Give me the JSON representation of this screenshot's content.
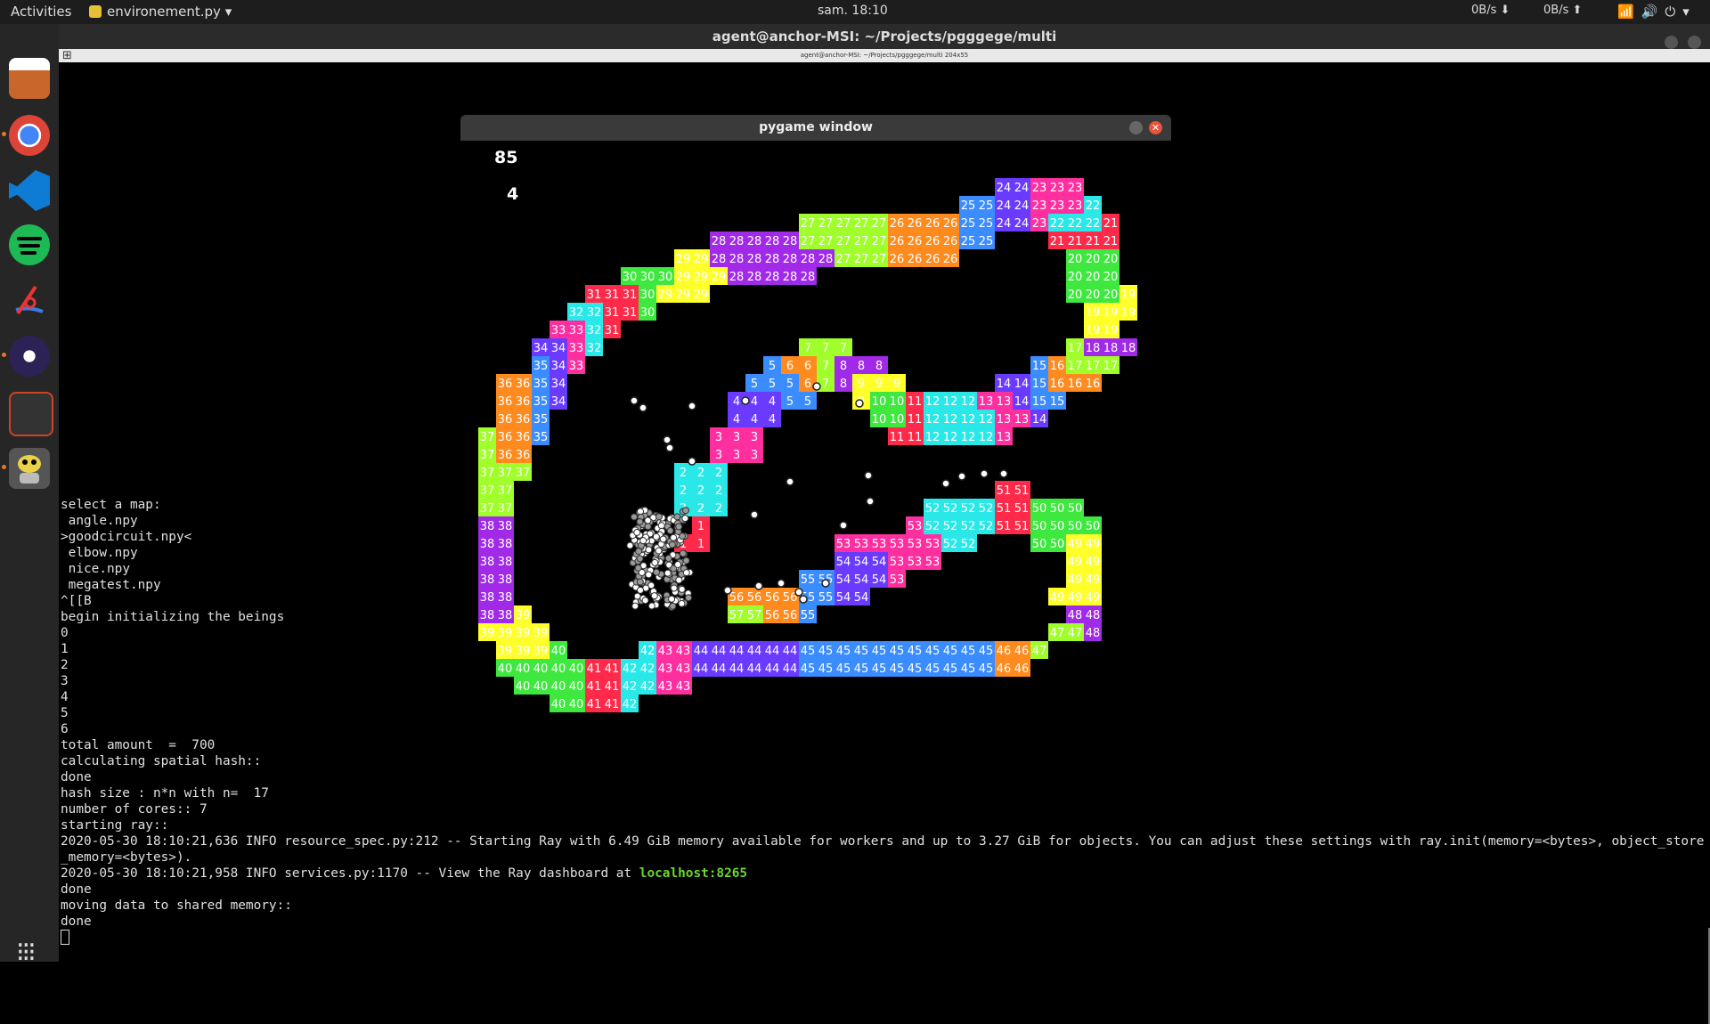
{
  "topbar": {
    "activities": "Activities",
    "app_name": "environement.py ▾",
    "clock": "sam. 18:10",
    "net_down": "0B/s ⬇",
    "net_up": "0B/s ⬆",
    "system_icons": "📶🔊⏻▾"
  },
  "terminal": {
    "title": "agent@anchor-MSI: ~/Projects/pgggege/multi",
    "tab_label": "agent@anchor-MSI: ~/Projects/pgggege/multi 204x55",
    "lines": [
      "select a map:",
      " angle.npy",
      ">goodcircuit.npy<",
      " elbow.npy",
      " nice.npy",
      " megatest.npy",
      "^[[B",
      "begin initializing the beings",
      "0",
      "1",
      "2",
      "3",
      "4",
      "5",
      "6",
      "total amount  =  700",
      "calculating spatial hash::",
      "done",
      "hash size : n*n with n=  17",
      "number of cores:: 7",
      "starting ray::",
      "2020-05-30 18:10:21,636 INFO resource_spec.py:212 -- Starting Ray with 6.49 GiB memory available for workers and up to 3.27 GiB for objects. You can adjust these settings with ray.init(memory=<bytes>, object_store_memory=<bytes>).",
      "2020-05-30 18:10:21,958 INFO services.py:1170 -- View the Ray dashboard at ",
      "done",
      "moving data to shared memory::",
      "done"
    ],
    "dashboard_link": "localhost:8265"
  },
  "pygame": {
    "title": "pygame window",
    "score": "85",
    "generation": "4",
    "close_glyph": "✕"
  },
  "palette": {
    "green": "#3ee83e",
    "pink": "#ff2fa0",
    "orange": "#ff8a1e",
    "yellow": "#ffff2a",
    "cyan": "#2ae8e8",
    "blue": "#3a8cff",
    "purple": "#a02ae8",
    "red": "#ff2a4a",
    "violet": "#6a3aff",
    "lime": "#a0ff2a"
  },
  "track_cells": [
    [
      3,
      0,
      24
    ],
    [
      4,
      0,
      24
    ],
    [
      5,
      0,
      23
    ],
    [
      6,
      0,
      23
    ],
    [
      7,
      0,
      23
    ],
    [
      1,
      1,
      25
    ],
    [
      2,
      1,
      25
    ],
    [
      3,
      1,
      24
    ],
    [
      4,
      1,
      24
    ],
    [
      5,
      1,
      23
    ],
    [
      6,
      1,
      23
    ],
    [
      7,
      1,
      23
    ],
    [
      8,
      1,
      22
    ],
    [
      -8,
      2,
      27
    ],
    [
      -7,
      2,
      27
    ],
    [
      -6,
      2,
      27
    ],
    [
      -5,
      2,
      27
    ],
    [
      -4,
      2,
      27
    ],
    [
      -3,
      2,
      26
    ],
    [
      -2,
      2,
      26
    ],
    [
      -1,
      2,
      26
    ],
    [
      0,
      2,
      26
    ],
    [
      1,
      2,
      25
    ],
    [
      2,
      2,
      25
    ],
    [
      3,
      2,
      24
    ],
    [
      4,
      2,
      24
    ],
    [
      5,
      2,
      23
    ],
    [
      6,
      2,
      22
    ],
    [
      7,
      2,
      22
    ],
    [
      8,
      2,
      22
    ],
    [
      9,
      2,
      21
    ],
    [
      -13,
      3,
      28
    ],
    [
      -12,
      3,
      28
    ],
    [
      -11,
      3,
      28
    ],
    [
      -10,
      3,
      28
    ],
    [
      -9,
      3,
      28
    ],
    [
      -8,
      3,
      27
    ],
    [
      -7,
      3,
      27
    ],
    [
      -6,
      3,
      27
    ],
    [
      -5,
      3,
      27
    ],
    [
      -4,
      3,
      27
    ],
    [
      -3,
      3,
      26
    ],
    [
      -2,
      3,
      26
    ],
    [
      -1,
      3,
      26
    ],
    [
      0,
      3,
      26
    ],
    [
      1,
      3,
      25
    ],
    [
      2,
      3,
      25
    ],
    [
      6,
      3,
      21
    ],
    [
      7,
      3,
      21
    ],
    [
      8,
      3,
      21
    ],
    [
      9,
      3,
      21
    ],
    [
      -15,
      4,
      29
    ],
    [
      -14,
      4,
      29
    ],
    [
      -13,
      4,
      28
    ],
    [
      -12,
      4,
      28
    ],
    [
      -11,
      4,
      28
    ],
    [
      -10,
      4,
      28
    ],
    [
      -9,
      4,
      28
    ],
    [
      -8,
      4,
      28
    ],
    [
      -7,
      4,
      28
    ],
    [
      -6,
      4,
      27
    ],
    [
      -5,
      4,
      27
    ],
    [
      -4,
      4,
      27
    ],
    [
      -3,
      4,
      26
    ],
    [
      -2,
      4,
      26
    ],
    [
      -1,
      4,
      26
    ],
    [
      0,
      4,
      26
    ],
    [
      7,
      4,
      20
    ],
    [
      8,
      4,
      20
    ],
    [
      9,
      4,
      20
    ],
    [
      -18,
      5,
      30
    ],
    [
      -17,
      5,
      30
    ],
    [
      -16,
      5,
      30
    ],
    [
      -15,
      5,
      29
    ],
    [
      -14,
      5,
      29
    ],
    [
      -13,
      5,
      29
    ],
    [
      -12,
      5,
      28
    ],
    [
      -11,
      5,
      28
    ],
    [
      -10,
      5,
      28
    ],
    [
      -9,
      5,
      28
    ],
    [
      -8,
      5,
      28
    ],
    [
      7,
      5,
      20
    ],
    [
      8,
      5,
      20
    ],
    [
      9,
      5,
      20
    ],
    [
      -20,
      6,
      31
    ],
    [
      -19,
      6,
      31
    ],
    [
      -18,
      6,
      31
    ],
    [
      -17,
      6,
      30
    ],
    [
      -16,
      6,
      29
    ],
    [
      -15,
      6,
      29
    ],
    [
      -14,
      6,
      29
    ],
    [
      7,
      6,
      20
    ],
    [
      8,
      6,
      20
    ],
    [
      9,
      6,
      20
    ],
    [
      10,
      6,
      19
    ],
    [
      -21,
      7,
      32
    ],
    [
      -20,
      7,
      32
    ],
    [
      -19,
      7,
      31
    ],
    [
      -18,
      7,
      31
    ],
    [
      -17,
      7,
      30
    ],
    [
      8,
      7,
      19
    ],
    [
      9,
      7,
      19
    ],
    [
      10,
      7,
      19
    ],
    [
      -22,
      8,
      33
    ],
    [
      -21,
      8,
      33
    ],
    [
      -20,
      8,
      32
    ],
    [
      -19,
      8,
      31
    ],
    [
      8,
      8,
      19
    ],
    [
      9,
      8,
      19
    ],
    [
      -23,
      9,
      34
    ],
    [
      -22,
      9,
      34
    ],
    [
      -21,
      9,
      33
    ],
    [
      -20,
      9,
      32
    ],
    [
      -8,
      9,
      7
    ],
    [
      -7,
      9,
      7
    ],
    [
      -6,
      9,
      7
    ],
    [
      7,
      9,
      17
    ],
    [
      8,
      9,
      18
    ],
    [
      9,
      9,
      18
    ],
    [
      10,
      9,
      18
    ],
    [
      -23,
      10,
      35
    ],
    [
      -22,
      10,
      34
    ],
    [
      -21,
      10,
      33
    ],
    [
      -10,
      10,
      5
    ],
    [
      -9,
      10,
      6
    ],
    [
      -8,
      10,
      6
    ],
    [
      -7,
      10,
      7
    ],
    [
      -6,
      10,
      8
    ],
    [
      -5,
      10,
      8
    ],
    [
      -4,
      10,
      8
    ],
    [
      5,
      10,
      15
    ],
    [
      6,
      10,
      16
    ],
    [
      7,
      10,
      17
    ],
    [
      8,
      10,
      17
    ],
    [
      9,
      10,
      17
    ],
    [
      -25,
      11,
      36
    ],
    [
      -24,
      11,
      36
    ],
    [
      -23,
      11,
      35
    ],
    [
      -22,
      11,
      34
    ],
    [
      -11,
      11,
      5
    ],
    [
      -10,
      11,
      5
    ],
    [
      -9,
      11,
      5
    ],
    [
      -8,
      11,
      6
    ],
    [
      -7,
      11,
      7
    ],
    [
      -6,
      11,
      8
    ],
    [
      -5,
      11,
      9
    ],
    [
      -4,
      11,
      9
    ],
    [
      -3,
      11,
      9
    ],
    [
      3,
      11,
      14
    ],
    [
      4,
      11,
      14
    ],
    [
      5,
      11,
      15
    ],
    [
      6,
      11,
      16
    ],
    [
      7,
      11,
      16
    ],
    [
      8,
      11,
      16
    ],
    [
      -25,
      12,
      36
    ],
    [
      -24,
      12,
      36
    ],
    [
      -23,
      12,
      35
    ],
    [
      -22,
      12,
      34
    ],
    [
      -12,
      12,
      4
    ],
    [
      -11,
      12,
      4
    ],
    [
      -10,
      12,
      4
    ],
    [
      -9,
      12,
      5
    ],
    [
      -8,
      12,
      5
    ],
    [
      -5,
      12,
      9
    ],
    [
      -4,
      12,
      10
    ],
    [
      -3,
      12,
      10
    ],
    [
      -2,
      12,
      11
    ],
    [
      -1,
      12,
      12
    ],
    [
      0,
      12,
      12
    ],
    [
      1,
      12,
      12
    ],
    [
      2,
      12,
      13
    ],
    [
      3,
      12,
      13
    ],
    [
      4,
      12,
      14
    ],
    [
      5,
      12,
      15
    ],
    [
      6,
      12,
      15
    ],
    [
      -25,
      13,
      36
    ],
    [
      -24,
      13,
      36
    ],
    [
      -23,
      13,
      35
    ],
    [
      -12,
      13,
      4
    ],
    [
      -11,
      13,
      4
    ],
    [
      -10,
      13,
      4
    ],
    [
      -4,
      13,
      10
    ],
    [
      -3,
      13,
      10
    ],
    [
      -2,
      13,
      11
    ],
    [
      -1,
      13,
      12
    ],
    [
      0,
      13,
      12
    ],
    [
      1,
      13,
      12
    ],
    [
      2,
      13,
      12
    ],
    [
      3,
      13,
      13
    ],
    [
      4,
      13,
      13
    ],
    [
      5,
      13,
      14
    ],
    [
      -26,
      14,
      37
    ],
    [
      -25,
      14,
      36
    ],
    [
      -24,
      14,
      36
    ],
    [
      -23,
      14,
      35
    ],
    [
      -13,
      14,
      3
    ],
    [
      -12,
      14,
      3
    ],
    [
      -11,
      14,
      3
    ],
    [
      -3,
      14,
      11
    ],
    [
      -2,
      14,
      11
    ],
    [
      -1,
      14,
      12
    ],
    [
      0,
      14,
      12
    ],
    [
      1,
      14,
      12
    ],
    [
      2,
      14,
      12
    ],
    [
      3,
      14,
      13
    ],
    [
      -26,
      15,
      37
    ],
    [
      -25,
      15,
      36
    ],
    [
      -24,
      15,
      36
    ],
    [
      -13,
      15,
      3
    ],
    [
      -12,
      15,
      3
    ],
    [
      -11,
      15,
      3
    ],
    [
      -26,
      16,
      37
    ],
    [
      -25,
      16,
      37
    ],
    [
      -24,
      16,
      37
    ],
    [
      -15,
      16,
      2
    ],
    [
      -14,
      16,
      2
    ],
    [
      -13,
      16,
      2
    ],
    [
      -26,
      17,
      37
    ],
    [
      -25,
      17,
      37
    ],
    [
      -15,
      17,
      2
    ],
    [
      -14,
      17,
      2
    ],
    [
      -13,
      17,
      2
    ],
    [
      3,
      17,
      51
    ],
    [
      4,
      17,
      51
    ],
    [
      -26,
      18,
      37
    ],
    [
      -25,
      18,
      37
    ],
    [
      -15,
      18,
      2
    ],
    [
      -14,
      18,
      2
    ],
    [
      -13,
      18,
      2
    ],
    [
      -1,
      18,
      52
    ],
    [
      0,
      18,
      52
    ],
    [
      1,
      18,
      52
    ],
    [
      2,
      18,
      52
    ],
    [
      3,
      18,
      51
    ],
    [
      4,
      18,
      51
    ],
    [
      5,
      18,
      50
    ],
    [
      6,
      18,
      50
    ],
    [
      7,
      18,
      50
    ],
    [
      -26,
      19,
      38
    ],
    [
      -25,
      19,
      38
    ],
    [
      -14,
      19,
      1
    ],
    [
      -2,
      19,
      53
    ],
    [
      -1,
      19,
      52
    ],
    [
      0,
      19,
      52
    ],
    [
      1,
      19,
      52
    ],
    [
      2,
      19,
      52
    ],
    [
      3,
      19,
      51
    ],
    [
      4,
      19,
      51
    ],
    [
      5,
      19,
      50
    ],
    [
      6,
      19,
      50
    ],
    [
      7,
      19,
      50
    ],
    [
      8,
      19,
      50
    ],
    [
      -26,
      20,
      38
    ],
    [
      -25,
      20,
      38
    ],
    [
      -15,
      20,
      1
    ],
    [
      -14,
      20,
      1
    ],
    [
      -6,
      20,
      53
    ],
    [
      -5,
      20,
      53
    ],
    [
      -4,
      20,
      53
    ],
    [
      -3,
      20,
      53
    ],
    [
      -2,
      20,
      53
    ],
    [
      -1,
      20,
      53
    ],
    [
      0,
      20,
      52
    ],
    [
      1,
      20,
      52
    ],
    [
      5,
      20,
      50
    ],
    [
      6,
      20,
      50
    ],
    [
      7,
      20,
      49
    ],
    [
      8,
      20,
      49
    ],
    [
      -26,
      21,
      38
    ],
    [
      -25,
      21,
      38
    ],
    [
      -6,
      21,
      54
    ],
    [
      -5,
      21,
      54
    ],
    [
      -4,
      21,
      54
    ],
    [
      -3,
      21,
      53
    ],
    [
      -2,
      21,
      53
    ],
    [
      -1,
      21,
      53
    ],
    [
      7,
      21,
      49
    ],
    [
      8,
      21,
      49
    ],
    [
      -26,
      22,
      38
    ],
    [
      -25,
      22,
      38
    ],
    [
      -8,
      22,
      55
    ],
    [
      -7,
      22,
      55
    ],
    [
      -6,
      22,
      54
    ],
    [
      -5,
      22,
      54
    ],
    [
      -4,
      22,
      54
    ],
    [
      -3,
      22,
      53
    ],
    [
      7,
      22,
      49
    ],
    [
      8,
      22,
      49
    ],
    [
      -26,
      23,
      38
    ],
    [
      -25,
      23,
      38
    ],
    [
      -12,
      23,
      56
    ],
    [
      -11,
      23,
      56
    ],
    [
      -10,
      23,
      56
    ],
    [
      -9,
      23,
      56
    ],
    [
      -8,
      23,
      55
    ],
    [
      -7,
      23,
      55
    ],
    [
      -6,
      23,
      54
    ],
    [
      -5,
      23,
      54
    ],
    [
      6,
      23,
      49
    ],
    [
      7,
      23,
      49
    ],
    [
      8,
      23,
      49
    ],
    [
      -26,
      24,
      38
    ],
    [
      -25,
      24,
      38
    ],
    [
      -24,
      24,
      39
    ],
    [
      -12,
      24,
      57
    ],
    [
      -11,
      24,
      57
    ],
    [
      -10,
      24,
      56
    ],
    [
      -9,
      24,
      56
    ],
    [
      -8,
      24,
      55
    ],
    [
      7,
      24,
      48
    ],
    [
      8,
      24,
      48
    ],
    [
      -26,
      25,
      39
    ],
    [
      -25,
      25,
      39
    ],
    [
      -24,
      25,
      39
    ],
    [
      -23,
      25,
      39
    ],
    [
      6,
      25,
      47
    ],
    [
      7,
      25,
      47
    ],
    [
      8,
      25,
      48
    ],
    [
      -25,
      26,
      39
    ],
    [
      -24,
      26,
      39
    ],
    [
      -23,
      26,
      39
    ],
    [
      -22,
      26,
      40
    ],
    [
      -17,
      26,
      42
    ],
    [
      -16,
      26,
      43
    ],
    [
      -15,
      26,
      43
    ],
    [
      -14,
      26,
      44
    ],
    [
      -13,
      26,
      44
    ],
    [
      -12,
      26,
      44
    ],
    [
      -11,
      26,
      44
    ],
    [
      -10,
      26,
      44
    ],
    [
      -9,
      26,
      44
    ],
    [
      -8,
      26,
      45
    ],
    [
      -7,
      26,
      45
    ],
    [
      -6,
      26,
      45
    ],
    [
      -5,
      26,
      45
    ],
    [
      -4,
      26,
      45
    ],
    [
      -3,
      26,
      45
    ],
    [
      -2,
      26,
      45
    ],
    [
      -1,
      26,
      45
    ],
    [
      0,
      26,
      45
    ],
    [
      1,
      26,
      45
    ],
    [
      2,
      26,
      45
    ],
    [
      3,
      26,
      46
    ],
    [
      4,
      26,
      46
    ],
    [
      5,
      26,
      47
    ],
    [
      -25,
      27,
      40
    ],
    [
      -24,
      27,
      40
    ],
    [
      -23,
      27,
      40
    ],
    [
      -22,
      27,
      40
    ],
    [
      -21,
      27,
      40
    ],
    [
      -20,
      27,
      41
    ],
    [
      -19,
      27,
      41
    ],
    [
      -18,
      27,
      42
    ],
    [
      -17,
      27,
      42
    ],
    [
      -16,
      27,
      43
    ],
    [
      -15,
      27,
      43
    ],
    [
      -14,
      27,
      44
    ],
    [
      -13,
      27,
      44
    ],
    [
      -12,
      27,
      44
    ],
    [
      -11,
      27,
      44
    ],
    [
      -10,
      27,
      44
    ],
    [
      -9,
      27,
      44
    ],
    [
      -8,
      27,
      45
    ],
    [
      -7,
      27,
      45
    ],
    [
      -6,
      27,
      45
    ],
    [
      -5,
      27,
      45
    ],
    [
      -4,
      27,
      45
    ],
    [
      -3,
      27,
      45
    ],
    [
      -2,
      27,
      45
    ],
    [
      -1,
      27,
      45
    ],
    [
      0,
      27,
      45
    ],
    [
      1,
      27,
      45
    ],
    [
      2,
      27,
      45
    ],
    [
      3,
      27,
      46
    ],
    [
      4,
      27,
      46
    ],
    [
      -24,
      28,
      40
    ],
    [
      -23,
      28,
      40
    ],
    [
      -22,
      28,
      40
    ],
    [
      -21,
      28,
      40
    ],
    [
      -20,
      28,
      41
    ],
    [
      -19,
      28,
      41
    ],
    [
      -18,
      28,
      42
    ],
    [
      -17,
      28,
      42
    ],
    [
      -16,
      28,
      43
    ],
    [
      -15,
      28,
      43
    ],
    [
      -22,
      29,
      40
    ],
    [
      -21,
      29,
      40
    ],
    [
      -20,
      29,
      41
    ],
    [
      -19,
      29,
      41
    ],
    [
      -18,
      29,
      42
    ]
  ]
}
